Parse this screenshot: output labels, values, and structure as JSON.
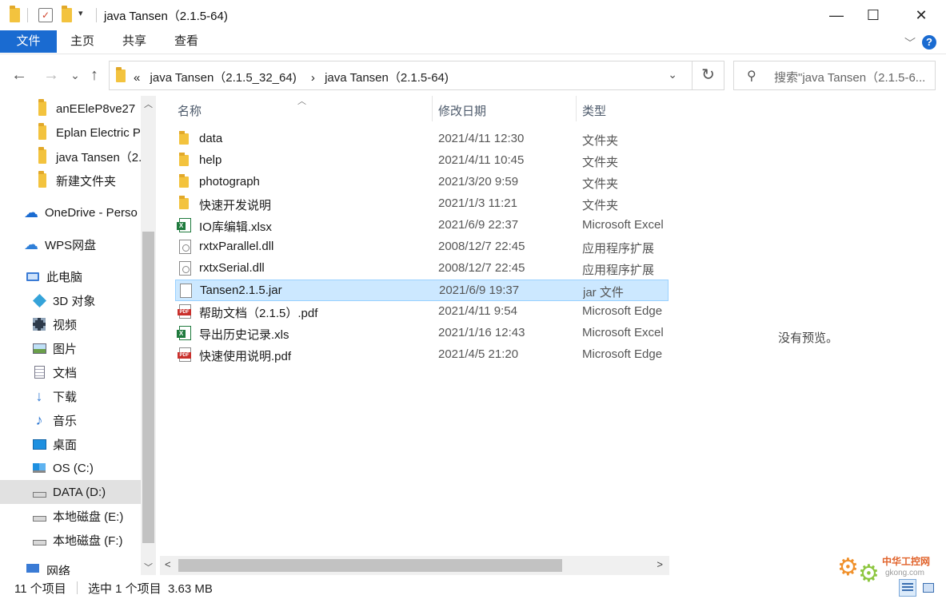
{
  "window": {
    "title": "java Tansen（2.1.5-64)",
    "minimize": "—",
    "maximize": "☐",
    "close": "✕"
  },
  "ribbon": {
    "tabs": [
      "文件",
      "主页",
      "共享",
      "查看"
    ],
    "help": "?",
    "collapse": "﹀"
  },
  "nav": {
    "back": "←",
    "forward": "→",
    "recent": "⌄",
    "up": "↑"
  },
  "address": {
    "overflow": "«",
    "crumbs": [
      "java Tansen（2.1.5_32_64)",
      "java Tansen（2.1.5-64)"
    ],
    "separator": "›",
    "dropdown": "⌄",
    "refresh": "↻"
  },
  "search": {
    "placeholder": "搜索\"java Tansen（2.1.5-6..."
  },
  "navpane": {
    "items": [
      {
        "label": "anEEleP8ve27",
        "icon": "folder-icon"
      },
      {
        "label": "Eplan Electric P",
        "icon": "folder-icon"
      },
      {
        "label": "java Tansen（2.",
        "icon": "folder-icon"
      },
      {
        "label": "新建文件夹",
        "icon": "folder-icon"
      },
      {
        "label": "OneDrive - Perso",
        "icon": "cloud-icon"
      },
      {
        "label": "WPS网盘",
        "icon": "cloud-icon"
      },
      {
        "label": "此电脑",
        "icon": "computer-icon"
      },
      {
        "label": "3D 对象",
        "icon": "cube-icon"
      },
      {
        "label": "视频",
        "icon": "video-icon"
      },
      {
        "label": "图片",
        "icon": "picture-icon"
      },
      {
        "label": "文档",
        "icon": "document-icon"
      },
      {
        "label": "下载",
        "icon": "download-icon"
      },
      {
        "label": "音乐",
        "icon": "music-icon"
      },
      {
        "label": "桌面",
        "icon": "desktop-icon"
      },
      {
        "label": "OS (C:)",
        "icon": "windows-drive-icon"
      },
      {
        "label": "DATA (D:)",
        "icon": "drive-icon"
      },
      {
        "label": "本地磁盘 (E:)",
        "icon": "drive-icon"
      },
      {
        "label": "本地磁盘 (F:)",
        "icon": "drive-icon"
      },
      {
        "label": "网络",
        "icon": "network-icon"
      }
    ],
    "selected_index": 15
  },
  "list": {
    "columns": {
      "name": "名称",
      "date": "修改日期",
      "type": "类型"
    },
    "rows": [
      {
        "name": "data",
        "date": "2021/4/11 12:30",
        "type": "文件夹",
        "icon": "folder-icon"
      },
      {
        "name": "help",
        "date": "2021/4/11 10:45",
        "type": "文件夹",
        "icon": "folder-icon"
      },
      {
        "name": "photograph",
        "date": "2021/3/20 9:59",
        "type": "文件夹",
        "icon": "folder-icon"
      },
      {
        "name": "快速开发说明",
        "date": "2021/1/3 11:21",
        "type": "文件夹",
        "icon": "folder-icon"
      },
      {
        "name": "IO库编辑.xlsx",
        "date": "2021/6/9 22:37",
        "type": "Microsoft Excel",
        "icon": "excel-icon"
      },
      {
        "name": "rxtxParallel.dll",
        "date": "2008/12/7 22:45",
        "type": "应用程序扩展",
        "icon": "dll-icon"
      },
      {
        "name": "rxtxSerial.dll",
        "date": "2008/12/7 22:45",
        "type": "应用程序扩展",
        "icon": "dll-icon"
      },
      {
        "name": "Tansen2.1.5.jar",
        "date": "2021/6/9 19:37",
        "type": "jar 文件",
        "icon": "file-icon"
      },
      {
        "name": "帮助文档（2.1.5）.pdf",
        "date": "2021/4/11 9:54",
        "type": "Microsoft Edge",
        "icon": "pdf-icon"
      },
      {
        "name": "导出历史记录.xls",
        "date": "2021/1/16 12:43",
        "type": "Microsoft Excel",
        "icon": "excel-icon"
      },
      {
        "name": "快速使用说明.pdf",
        "date": "2021/4/5 21:20",
        "type": "Microsoft Edge",
        "icon": "pdf-icon"
      }
    ],
    "selected_index": 7
  },
  "preview": {
    "message": "没有预览。"
  },
  "status": {
    "count": "11 个项目",
    "selection": "选中 1 个项目  3.63 MB"
  },
  "watermark": {
    "line1": "中华工控网",
    "line2": "gkong.com"
  },
  "colors": {
    "accent": "#1a6bd1",
    "selection_bg": "#cce8ff",
    "selection_border": "#99d1ff",
    "folder": "#f3c33e"
  }
}
